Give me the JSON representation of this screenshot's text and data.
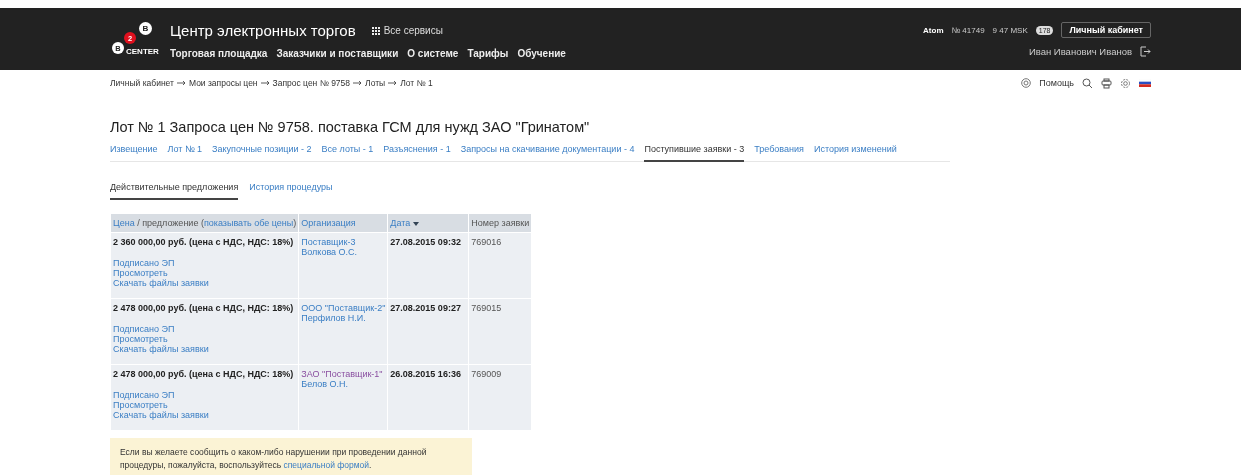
{
  "logo": {
    "top_letter": "B",
    "badge": "2",
    "left_letter": "B",
    "caption": "CENTER"
  },
  "header": {
    "title": "Центр электронных торгов",
    "services": "Все сервисы",
    "nav": [
      "Торговая площадка",
      "Заказчики и поставщики",
      "О системе",
      "Тарифы",
      "Обучение"
    ],
    "company": "Atom",
    "account_number": "№ 41749",
    "time": "9 47 MSK",
    "messages_count": "178",
    "cabinet_button": "Личный кабинет",
    "user_name": "Иван Иванович Иванов"
  },
  "breadcrumbs": [
    "Личный кабинет",
    "Мои запросы цен",
    "Запрос цен № 9758",
    "Лоты",
    "Лот № 1"
  ],
  "toolbar": {
    "help": "Помощь"
  },
  "page_title": "Лот № 1 Запроса цен № 9758. поставка ГСМ для нужд ЗАО \"Гринатом\"",
  "tabs": [
    {
      "label": "Извещение",
      "selected": false
    },
    {
      "label": "Лот № 1",
      "selected": false
    },
    {
      "label": "Закупочные позиции - 2",
      "selected": false
    },
    {
      "label": "Все лоты - 1",
      "selected": false
    },
    {
      "label": "Разъяснения - 1",
      "selected": false
    },
    {
      "label": "Запросы на скачивание документации - 4",
      "selected": false
    },
    {
      "label": "Поступившие заявки - 3",
      "selected": true
    },
    {
      "label": "Требования",
      "selected": false
    },
    {
      "label": "История изменений",
      "selected": false
    }
  ],
  "subtabs": [
    {
      "label": "Действительные предложения",
      "selected": true
    },
    {
      "label": "История процедуры",
      "selected": false
    }
  ],
  "table": {
    "columns": {
      "price_link": "Цена",
      "price_rest": "/ предложение (",
      "price_toggle": "показывать обе цены",
      "price_close": ")",
      "organization": "Организация",
      "date": "Дата",
      "number": "Номер заявки"
    },
    "rows": [
      {
        "price": "2 360 000,00 руб. (цена с НДС, НДС: 18%)",
        "links": [
          "Подписано ЭП",
          "Просмотреть",
          "Скачать файлы заявки"
        ],
        "organization": "Поставщик-3",
        "organization_visited": false,
        "contact": "Волкова О.С.",
        "date": "27.08.2015 09:32",
        "number": "769016"
      },
      {
        "price": "2 478 000,00 руб. (цена с НДС, НДС: 18%)",
        "links": [
          "Подписано ЭП",
          "Просмотреть",
          "Скачать файлы заявки"
        ],
        "organization": "ООО \"Поставщик-2\"",
        "organization_visited": false,
        "contact": "Перфилов Н.И.",
        "date": "27.08.2015 09:27",
        "number": "769015"
      },
      {
        "price": "2 478 000,00 руб. (цена с НДС, НДС: 18%)",
        "links": [
          "Подписано ЭП",
          "Просмотреть",
          "Скачать файлы заявки"
        ],
        "organization": "ЗАО \"Поставщик-1\"",
        "organization_visited": true,
        "contact": "Белов О.Н.",
        "date": "26.08.2015 16:36",
        "number": "769009"
      }
    ]
  },
  "notice": {
    "text": "Если вы желаете сообщить о каком-либо нарушении при проведении данной процедуры, пожалуйста, воспользуйтесь ",
    "link": "специальной формой",
    "end": "."
  }
}
